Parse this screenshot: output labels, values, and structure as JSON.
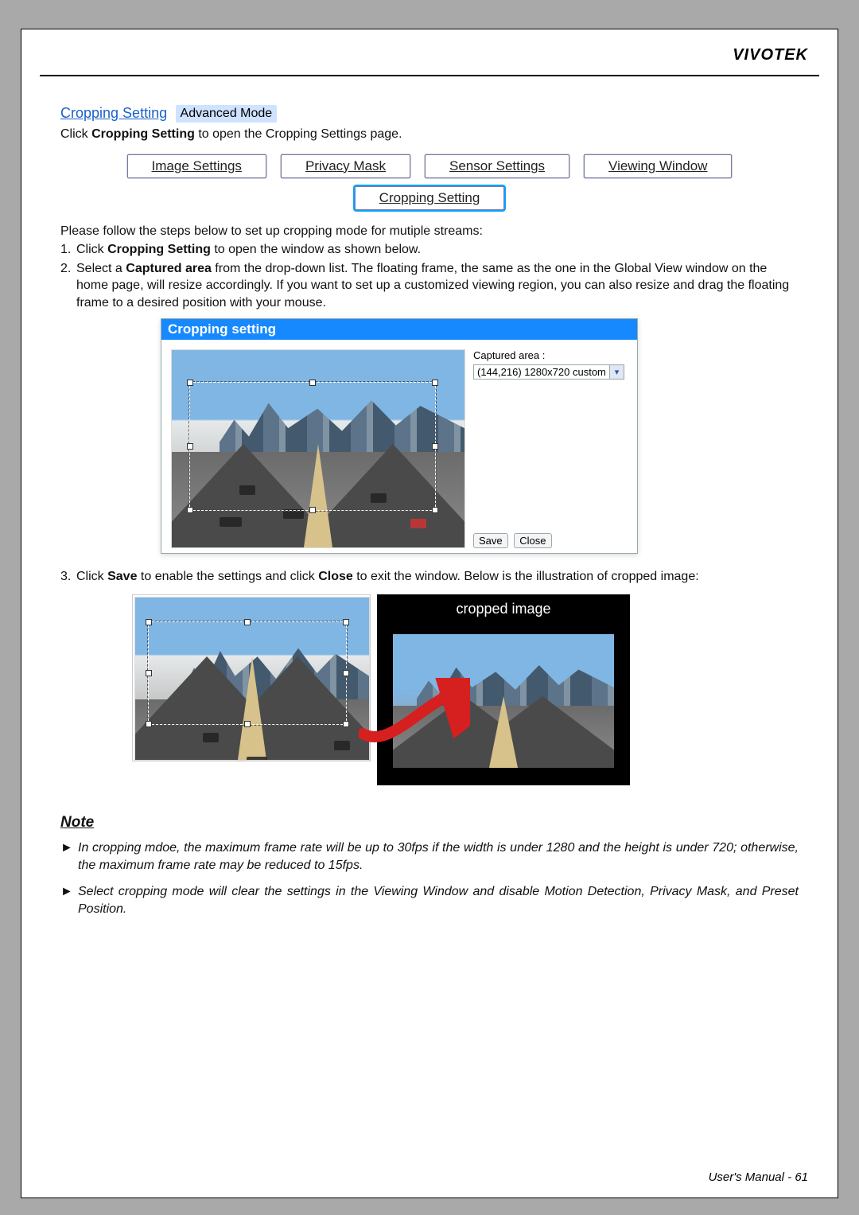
{
  "brand": "VIVOTEK",
  "section": {
    "title": "Cropping Setting",
    "mode": "Advanced Mode"
  },
  "intro": {
    "prefix": "Click ",
    "strong": "Cropping Setting",
    "suffix": " to open the Cropping Settings page."
  },
  "tabs": {
    "row1": [
      "Image Settings",
      "Privacy Mask",
      "Sensor Settings",
      "Viewing Window"
    ],
    "row2": "Cropping Setting"
  },
  "steps_intro": "Please follow the steps below to set up cropping mode for mutiple streams:",
  "step1": {
    "n": "1.",
    "prefix": "Click ",
    "strong": "Cropping Setting",
    "suffix": " to open the window as shown below."
  },
  "step2": {
    "n": "2.",
    "prefix": "Select a ",
    "strong": "Captured area",
    "rest": " from the drop-down list. The floating frame, the same as the one in the Global View window on the home page, will resize accordingly. If you want to set up a customized viewing region, you can also resize and drag the floating frame to a desired position with your mouse."
  },
  "cropwin": {
    "title": "Cropping setting",
    "captured_label": "Captured area :",
    "dropdown": "(144,216) 1280x720 custom",
    "save": "Save",
    "close": "Close"
  },
  "step3": {
    "n": "3.",
    "t1": "Click ",
    "s1": "Save",
    "t2": " to enable the settings and click ",
    "s2": "Close",
    "t3": " to exit the window. Below is the illustration of cropped image:"
  },
  "compare_label": "cropped image",
  "note_heading": "Note",
  "notes": [
    "In cropping mdoe, the maximum frame rate will be up to 30fps if the width is under 1280 and the height is under 720; otherwise, the maximum frame rate may be reduced to 15fps.",
    "Select cropping mode will clear the settings in the Viewing Window and disable Motion Detection, Privacy Mask, and Preset Position."
  ],
  "footer": {
    "label": "User's Manual - ",
    "page": "61"
  },
  "glyph": {
    "chevron": "▾",
    "tri": "►"
  }
}
